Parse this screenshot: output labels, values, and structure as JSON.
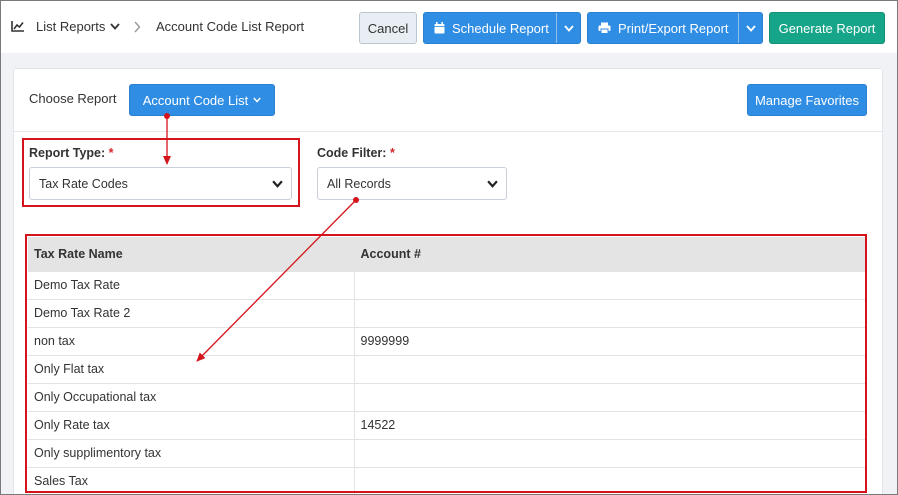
{
  "breadcrumb": {
    "root_label": "List Reports",
    "current_label": "Account Code List Report"
  },
  "toolbar": {
    "cancel_label": "Cancel",
    "schedule_label": "Schedule Report",
    "print_label": "Print/Export Report",
    "generate_label": "Generate Report"
  },
  "report": {
    "choose_label": "Choose Report",
    "choose_value": "Account Code List",
    "favorites_label": "Manage Favorites"
  },
  "filters": {
    "report_type_label": "Report Type:",
    "report_type_value": "Tax Rate Codes",
    "code_filter_label": "Code Filter:",
    "code_filter_value": "All Records",
    "required_marker": "*"
  },
  "table": {
    "headers": [
      "Tax Rate Name",
      "Account #"
    ],
    "rows": [
      [
        "Demo Tax Rate",
        ""
      ],
      [
        "Demo Tax Rate 2",
        ""
      ],
      [
        "non tax",
        "9999999"
      ],
      [
        "Only Flat tax",
        ""
      ],
      [
        "Only Occupational tax",
        ""
      ],
      [
        "Only Rate tax",
        "14522"
      ],
      [
        "Only supplimentory tax",
        ""
      ],
      [
        "Sales Tax",
        ""
      ]
    ]
  },
  "colors": {
    "primary_button": "#2f8de4",
    "generate_button": "#17a589",
    "annotation_red": "#d4141a"
  },
  "icons": {
    "breadcrumb": "line-chart-icon",
    "schedule": "calendar-icon",
    "print": "printer-icon"
  }
}
